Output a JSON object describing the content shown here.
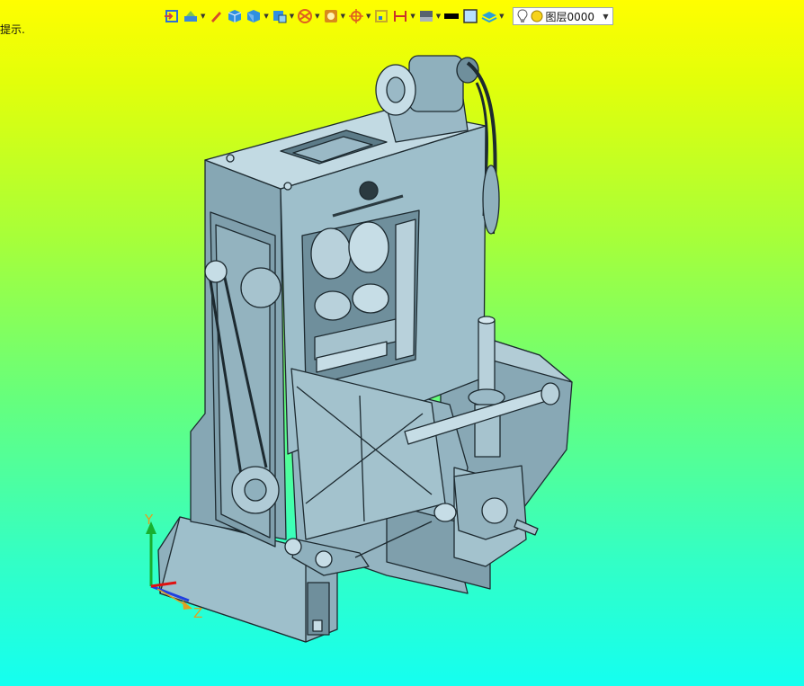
{
  "hint_text": "提示.",
  "toolbar": {
    "buttons": [
      {
        "name": "import-icon",
        "color": "#2c6fd6",
        "dropdown": false
      },
      {
        "name": "scene-icon",
        "color": "#3a86d9",
        "dropdown": true
      },
      {
        "name": "pen-icon",
        "color": "#d54a2a",
        "dropdown": false
      },
      {
        "name": "shaded-cube-icon",
        "color": "#2f8fe0",
        "dropdown": false
      },
      {
        "name": "render-cube-icon",
        "color": "#2f8fe0",
        "dropdown": true
      },
      {
        "name": "view-cube-icon",
        "color": "#2f8fe0",
        "dropdown": true
      },
      {
        "name": "section-icon",
        "color": "#e06020",
        "dropdown": true
      },
      {
        "name": "material-icon",
        "color": "#d88a1a",
        "dropdown": true
      },
      {
        "name": "target-icon",
        "color": "#e06020",
        "dropdown": true
      },
      {
        "name": "frame-icon",
        "color": "#c6a92a",
        "dropdown": false
      },
      {
        "name": "dimension-icon",
        "color": "#c9342a",
        "dropdown": true
      },
      {
        "name": "background-icon",
        "color": "#58636e",
        "dropdown": true
      },
      {
        "name": "line-color-icon",
        "color": "#000000",
        "dropdown": false
      },
      {
        "name": "fill-color-icon",
        "color": "#b8e0ff",
        "dropdown": false
      },
      {
        "name": "layers-icon",
        "color": "#2aa0d8",
        "dropdown": true
      }
    ]
  },
  "layer_select": {
    "value": "图层0000",
    "bulb_icon": "lightbulb-icon",
    "dot_color": "#f7d31a"
  },
  "axes": {
    "y_label": "Y",
    "z_label": "Z"
  },
  "colors": {
    "body": "#9ab9c6",
    "body_dark": "#6f8f9c",
    "body_light": "#c6dde6",
    "edge": "#1d2a30",
    "axis_y": "#18b030",
    "axis_x": "#e01010",
    "axis_z": "#2040e0"
  }
}
